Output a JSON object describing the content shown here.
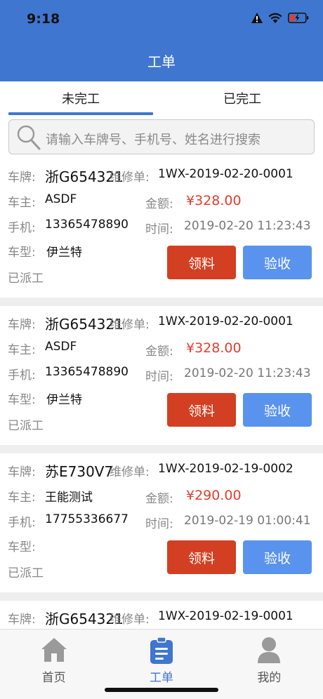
{
  "status_bar": {
    "time": "9:18"
  },
  "header": {
    "title": "工单"
  },
  "tabs": [
    {
      "label": "未完工",
      "active": true
    },
    {
      "label": "已完工",
      "active": false
    }
  ],
  "search": {
    "placeholder": "请输入车牌号、手机号、姓名进行搜索"
  },
  "labels": {
    "plate": "车牌:",
    "repair_no": "维修单:",
    "owner": "车主:",
    "amount": "金额:",
    "phone": "手机:",
    "time": "时间:",
    "model": "车型:",
    "btn_pick": "领料",
    "btn_accept": "验收"
  },
  "orders": [
    {
      "plate": "浙G654321",
      "repair_no": "1WX-2019-02-20-0001",
      "owner": "ASDF",
      "amount": "¥328.00",
      "phone": "13365478890",
      "time": "2019-02-20 11:23:43",
      "model": "伊兰特",
      "status": "已派工"
    },
    {
      "plate": "浙G654321",
      "repair_no": "1WX-2019-02-20-0001",
      "owner": "ASDF",
      "amount": "¥328.00",
      "phone": "13365478890",
      "time": "2019-02-20 11:23:43",
      "model": "伊兰特",
      "status": "已派工"
    },
    {
      "plate": "苏E730V7",
      "repair_no": "1WX-2019-02-19-0002",
      "owner": "王能测试",
      "amount": "¥290.00",
      "phone": "17755336677",
      "time": "2019-02-19 01:00:41",
      "model": "",
      "status": "已派工"
    },
    {
      "plate": "浙G654321",
      "repair_no": "1WX-2019-02-19-0001"
    }
  ],
  "tabbar": [
    {
      "label": "首页",
      "icon": "home-icon",
      "active": false
    },
    {
      "label": "工单",
      "icon": "clipboard-icon",
      "active": true
    },
    {
      "label": "我的",
      "icon": "user-icon",
      "active": false
    }
  ],
  "colors": {
    "primary": "#3f76cf",
    "danger": "#d33f22",
    "accent": "#5a93ee",
    "price": "#e33c2f"
  }
}
